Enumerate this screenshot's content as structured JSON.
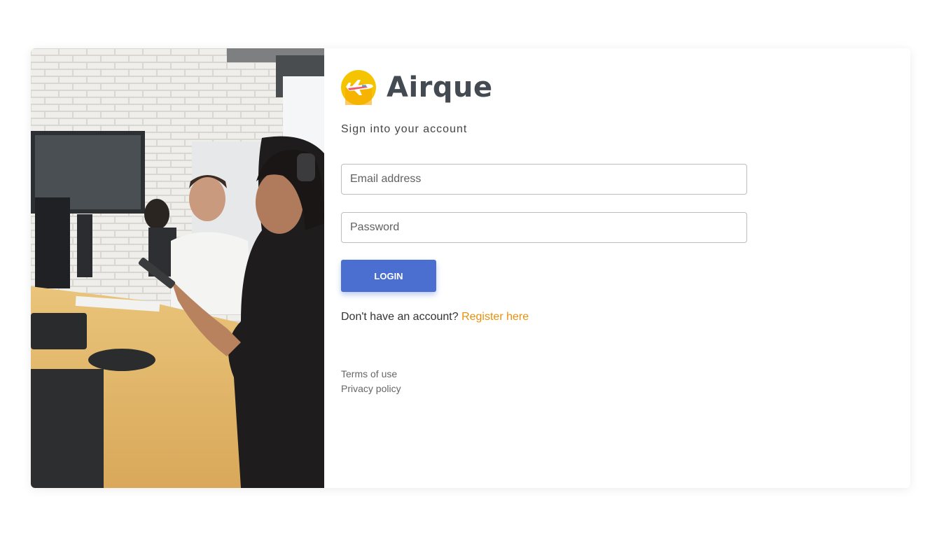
{
  "brand": {
    "name": "Airque",
    "logo_icon": "airplane-logo-icon"
  },
  "photo": {
    "icon": "call-center-photo"
  },
  "form": {
    "subtitle": "Sign into your account",
    "email_placeholder": "Email address",
    "password_placeholder": "Password",
    "login_label": "LOGIN",
    "register_prompt": "Don't have an account?",
    "register_link": "Register here"
  },
  "footer": {
    "terms": "Terms of use",
    "privacy": "Privacy policy"
  },
  "colors": {
    "primary_button": "#4a6fd1",
    "link_accent": "#e8900d",
    "logo_yellow": "#f5c400"
  }
}
